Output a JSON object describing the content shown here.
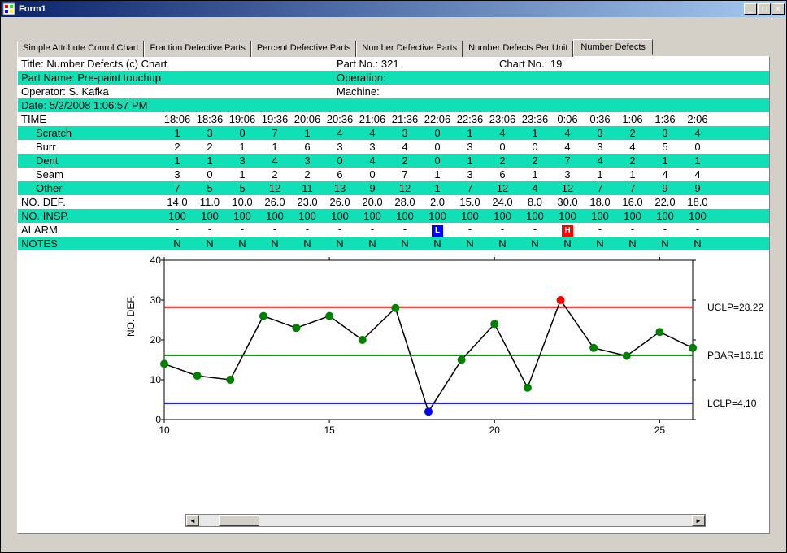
{
  "window": {
    "title": "Form1"
  },
  "tabs": [
    {
      "label": "Simple Attribute Conrol Chart",
      "active": false
    },
    {
      "label": "Fraction Defective Parts",
      "active": false
    },
    {
      "label": "Percent Defective Parts",
      "active": false
    },
    {
      "label": "Number Defective Parts",
      "active": false
    },
    {
      "label": "Number Defects Per Unit",
      "active": false
    },
    {
      "label": "Number Defects",
      "active": true
    }
  ],
  "meta": {
    "title_label": "Title:",
    "title_value": "Number Defects (c) Chart",
    "partno_label": "Part No.:",
    "partno_value": "321",
    "chartno_label": "Chart No.:",
    "chartno_value": "19",
    "partname_label": "Part Name:",
    "partname_value": "Pre-paint touchup",
    "operation_label": "Operation:",
    "operation_value": "",
    "operator_label": "Operator:",
    "operator_value": "S. Kafka",
    "machine_label": "Machine:",
    "machine_value": "",
    "date_label": "Date:",
    "date_value": "5/2/2008 1:06:57 PM"
  },
  "grid": {
    "time_label": "TIME",
    "times": [
      "18:06",
      "18:36",
      "19:06",
      "19:36",
      "20:06",
      "20:36",
      "21:06",
      "21:36",
      "22:06",
      "22:36",
      "23:06",
      "23:36",
      "0:06",
      "0:36",
      "1:06",
      "1:36",
      "2:06"
    ],
    "categories": [
      {
        "name": "Scratch",
        "vals": [
          1,
          3,
          0,
          7,
          1,
          4,
          4,
          3,
          0,
          1,
          4,
          1,
          4,
          3,
          2,
          3,
          4
        ]
      },
      {
        "name": "Burr",
        "vals": [
          2,
          2,
          1,
          1,
          6,
          3,
          3,
          4,
          0,
          3,
          0,
          0,
          4,
          3,
          4,
          5,
          0
        ]
      },
      {
        "name": "Dent",
        "vals": [
          1,
          1,
          3,
          4,
          3,
          0,
          4,
          2,
          0,
          1,
          2,
          2,
          7,
          4,
          2,
          1,
          1
        ]
      },
      {
        "name": "Seam",
        "vals": [
          3,
          0,
          1,
          2,
          2,
          6,
          0,
          7,
          1,
          3,
          6,
          1,
          3,
          1,
          1,
          4,
          4
        ]
      },
      {
        "name": "Other",
        "vals": [
          7,
          5,
          5,
          12,
          11,
          13,
          9,
          12,
          1,
          7,
          12,
          4,
          12,
          7,
          7,
          9,
          9
        ]
      }
    ],
    "no_def_label": "NO. DEF.",
    "no_def": [
      "14.0",
      "11.0",
      "10.0",
      "26.0",
      "23.0",
      "26.0",
      "20.0",
      "28.0",
      "2.0",
      "15.0",
      "24.0",
      "8.0",
      "30.0",
      "18.0",
      "16.0",
      "22.0",
      "18.0"
    ],
    "no_insp_label": "NO. INSP.",
    "no_insp": [
      "100",
      "100",
      "100",
      "100",
      "100",
      "100",
      "100",
      "100",
      "100",
      "100",
      "100",
      "100",
      "100",
      "100",
      "100",
      "100",
      "100"
    ],
    "alarm_label": "ALARM",
    "alarm": [
      "-",
      "-",
      "-",
      "-",
      "-",
      "-",
      "-",
      "-",
      "L",
      "-",
      "-",
      "-",
      "H",
      "-",
      "-",
      "-",
      "-"
    ],
    "notes_label": "NOTES",
    "notes": [
      "N",
      "N",
      "N",
      "N",
      "N",
      "N",
      "N",
      "N",
      "N",
      "N",
      "N",
      "N",
      "N",
      "N",
      "N",
      "N",
      "N"
    ]
  },
  "chart_data": {
    "type": "line",
    "ylabel": "NO. DEF.",
    "x": [
      10,
      11,
      12,
      13,
      14,
      15,
      16,
      17,
      18,
      19,
      20,
      21,
      22,
      23,
      24,
      25,
      26
    ],
    "y": [
      14,
      11,
      10,
      26,
      23,
      26,
      20,
      28,
      2,
      15,
      24,
      8,
      30,
      18,
      16,
      22,
      18
    ],
    "point_colors": [
      "green",
      "green",
      "green",
      "green",
      "green",
      "green",
      "green",
      "green",
      "blue",
      "green",
      "green",
      "green",
      "red",
      "green",
      "green",
      "green",
      "green"
    ],
    "ylim": [
      0,
      40
    ],
    "xlim": [
      10,
      26
    ],
    "yticks": [
      0,
      10,
      20,
      30,
      40
    ],
    "xticks": [
      10,
      15,
      20,
      25
    ],
    "lines": [
      {
        "label": "UCLP",
        "value": 28.22,
        "color": "#ff0000",
        "text": "UCLP=28.22"
      },
      {
        "label": "PBAR",
        "value": 16.16,
        "color": "#008000",
        "text": "PBAR=16.16"
      },
      {
        "label": "LCLP",
        "value": 4.1,
        "color": "#0000ff",
        "text": "LCLP=4.10"
      }
    ]
  }
}
